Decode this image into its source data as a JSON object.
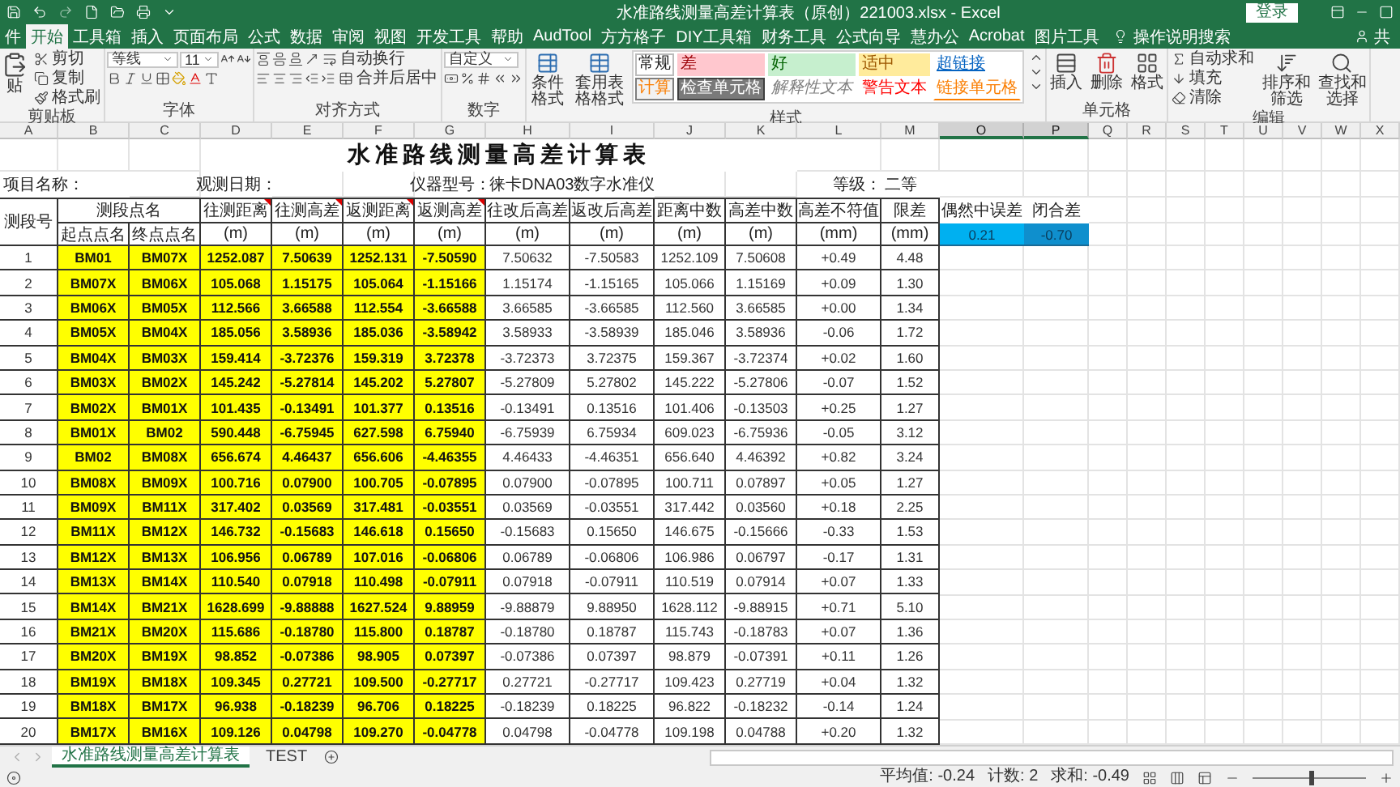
{
  "title_bar": {
    "title": "水准路线测量高差计算表（原创）221003.xlsx  -  Excel",
    "login": "登录"
  },
  "menu_tabs": [
    {
      "label": "件",
      "selected": false
    },
    {
      "label": "开始",
      "selected": true
    },
    {
      "label": "工具箱",
      "selected": false
    },
    {
      "label": "插入",
      "selected": false
    },
    {
      "label": "页面布局",
      "selected": false
    },
    {
      "label": "公式",
      "selected": false
    },
    {
      "label": "数据",
      "selected": false
    },
    {
      "label": "审阅",
      "selected": false
    },
    {
      "label": "视图",
      "selected": false
    },
    {
      "label": "开发工具",
      "selected": false
    },
    {
      "label": "帮助",
      "selected": false
    },
    {
      "label": "AudTool",
      "selected": false
    },
    {
      "label": "方方格子",
      "selected": false
    },
    {
      "label": "DIY工具箱",
      "selected": false
    },
    {
      "label": "财务工具",
      "selected": false
    },
    {
      "label": "公式向导",
      "selected": false
    },
    {
      "label": "慧办公",
      "selected": false
    },
    {
      "label": "Acrobat",
      "selected": false
    },
    {
      "label": "图片工具",
      "selected": false
    }
  ],
  "tell_me": "操作说明搜索",
  "share": "共",
  "ribbon": {
    "groups": [
      {
        "kind": "clipboard",
        "label": "剪贴板",
        "items": [
          "贴",
          "剪切",
          "复制",
          "格式刷"
        ]
      },
      {
        "kind": "font",
        "label": "字体",
        "font_name": "等线",
        "font_size": "11"
      },
      {
        "kind": "alignment",
        "label": "对齐方式",
        "items": [
          "自动换行",
          "合并后居中"
        ]
      },
      {
        "kind": "number",
        "label": "数字",
        "format": "自定义"
      },
      {
        "kind": "styles",
        "label": "样式",
        "buttons": [
          "条件格式",
          "套用表格格式"
        ],
        "styles": [
          {
            "label": "常规",
            "kind": "normal"
          },
          {
            "label": "差",
            "kind": "bad"
          },
          {
            "label": "好",
            "kind": "good"
          },
          {
            "label": "适中",
            "kind": "neutral"
          },
          {
            "label": "超链接",
            "kind": "hyperlink"
          },
          {
            "label": "计算",
            "kind": "calculation"
          },
          {
            "label": "检查单元格",
            "kind": "check"
          },
          {
            "label": "解释性文本",
            "kind": "explanatory"
          },
          {
            "label": "警告文本",
            "kind": "warning"
          },
          {
            "label": "链接单元格",
            "kind": "linked"
          }
        ]
      },
      {
        "kind": "cells",
        "label": "单元格",
        "items": [
          "插入",
          "删除",
          "格式"
        ]
      },
      {
        "kind": "editing",
        "label": "编辑",
        "items": [
          "自动求和",
          "填充",
          "清除"
        ],
        "buttons": [
          "排序和筛选",
          "查找和选择"
        ]
      }
    ]
  },
  "sheet": {
    "columns": [
      {
        "label": "A",
        "selected": false
      },
      {
        "label": "B",
        "selected": false
      },
      {
        "label": "C",
        "selected": false
      },
      {
        "label": "D",
        "selected": false
      },
      {
        "label": "E",
        "selected": false
      },
      {
        "label": "F",
        "selected": false
      },
      {
        "label": "G",
        "selected": false
      },
      {
        "label": "H",
        "selected": false
      },
      {
        "label": "I",
        "selected": false
      },
      {
        "label": "J",
        "selected": false
      },
      {
        "label": "K",
        "selected": false
      },
      {
        "label": "L",
        "selected": false
      },
      {
        "label": "M",
        "selected": false
      },
      {
        "label": "O",
        "selected": true
      },
      {
        "label": "P",
        "selected": true
      },
      {
        "label": "Q",
        "selected": false
      },
      {
        "label": "R",
        "selected": false
      },
      {
        "label": "S",
        "selected": false
      },
      {
        "label": "T",
        "selected": false
      },
      {
        "label": "U",
        "selected": false
      },
      {
        "label": "V",
        "selected": false
      },
      {
        "label": "W",
        "selected": false
      },
      {
        "label": "X",
        "selected": false
      }
    ],
    "title": "水准路线测量高差计算表",
    "info": {
      "project_label": "项目名称：",
      "date_label": "观测日期：",
      "instrument_label": "仪器型号：",
      "instrument": "徕卡DNA03数字水准仪",
      "grade_label": "等级：",
      "grade": "二等"
    },
    "table": {
      "segment_header": "测段号",
      "points_header": "测段点名",
      "point_headers": [
        "起点点名",
        "终点点名"
      ],
      "measure_headers": [
        {
          "label": "往测距离",
          "unit": "(m)",
          "comment": true
        },
        {
          "label": "往测高差",
          "unit": "(m)",
          "comment": true
        },
        {
          "label": "返测距离",
          "unit": "(m)",
          "comment": true
        },
        {
          "label": "返测高差",
          "unit": "(m)",
          "comment": true
        },
        {
          "label": "往改后高差",
          "unit": "(m)",
          "comment": false
        },
        {
          "label": "返改后高差",
          "unit": "(m)",
          "comment": false
        },
        {
          "label": "距离中数",
          "unit": "(m)",
          "comment": false
        },
        {
          "label": "高差中数",
          "unit": "(m)",
          "comment": false
        },
        {
          "label": "高差不符值",
          "unit": "(mm)",
          "comment": false
        },
        {
          "label": "限差",
          "unit": "(mm)",
          "comment": false
        }
      ],
      "rows": [
        {
          "no": "1",
          "cells": [
            "BM01",
            "BM07X",
            "1252.087",
            "7.50639",
            "1252.131",
            "-7.50590",
            "7.50632",
            "-7.50583",
            "1252.109",
            "7.50608",
            "+0.49",
            "4.48"
          ]
        },
        {
          "no": "2",
          "cells": [
            "BM07X",
            "BM06X",
            "105.068",
            "1.15175",
            "105.064",
            "-1.15166",
            "1.15174",
            "-1.15165",
            "105.066",
            "1.15169",
            "+0.09",
            "1.30"
          ]
        },
        {
          "no": "3",
          "cells": [
            "BM06X",
            "BM05X",
            "112.566",
            "3.66588",
            "112.554",
            "-3.66588",
            "3.66585",
            "-3.66585",
            "112.560",
            "3.66585",
            "+0.00",
            "1.34"
          ]
        },
        {
          "no": "4",
          "cells": [
            "BM05X",
            "BM04X",
            "185.056",
            "3.58936",
            "185.036",
            "-3.58942",
            "3.58933",
            "-3.58939",
            "185.046",
            "3.58936",
            "-0.06",
            "1.72"
          ]
        },
        {
          "no": "5",
          "cells": [
            "BM04X",
            "BM03X",
            "159.414",
            "-3.72376",
            "159.319",
            "3.72378",
            "-3.72373",
            "3.72375",
            "159.367",
            "-3.72374",
            "+0.02",
            "1.60"
          ]
        },
        {
          "no": "6",
          "cells": [
            "BM03X",
            "BM02X",
            "145.242",
            "-5.27814",
            "145.202",
            "5.27807",
            "-5.27809",
            "5.27802",
            "145.222",
            "-5.27806",
            "-0.07",
            "1.52"
          ]
        },
        {
          "no": "7",
          "cells": [
            "BM02X",
            "BM01X",
            "101.435",
            "-0.13491",
            "101.377",
            "0.13516",
            "-0.13491",
            "0.13516",
            "101.406",
            "-0.13503",
            "+0.25",
            "1.27"
          ]
        },
        {
          "no": "8",
          "cells": [
            "BM01X",
            "BM02",
            "590.448",
            "-6.75945",
            "627.598",
            "6.75940",
            "-6.75939",
            "6.75934",
            "609.023",
            "-6.75936",
            "-0.05",
            "3.12"
          ]
        },
        {
          "no": "9",
          "cells": [
            "BM02",
            "BM08X",
            "656.674",
            "4.46437",
            "656.606",
            "-4.46355",
            "4.46433",
            "-4.46351",
            "656.640",
            "4.46392",
            "+0.82",
            "3.24"
          ]
        },
        {
          "no": "10",
          "cells": [
            "BM08X",
            "BM09X",
            "100.716",
            "0.07900",
            "100.705",
            "-0.07895",
            "0.07900",
            "-0.07895",
            "100.711",
            "0.07897",
            "+0.05",
            "1.27"
          ]
        },
        {
          "no": "11",
          "cells": [
            "BM09X",
            "BM11X",
            "317.402",
            "0.03569",
            "317.481",
            "-0.03551",
            "0.03569",
            "-0.03551",
            "317.442",
            "0.03560",
            "+0.18",
            "2.25"
          ]
        },
        {
          "no": "12",
          "cells": [
            "BM11X",
            "BM12X",
            "146.732",
            "-0.15683",
            "146.618",
            "0.15650",
            "-0.15683",
            "0.15650",
            "146.675",
            "-0.15666",
            "-0.33",
            "1.53"
          ]
        },
        {
          "no": "13",
          "cells": [
            "BM12X",
            "BM13X",
            "106.956",
            "0.06789",
            "107.016",
            "-0.06806",
            "0.06789",
            "-0.06806",
            "106.986",
            "0.06797",
            "-0.17",
            "1.31"
          ]
        },
        {
          "no": "14",
          "cells": [
            "BM13X",
            "BM14X",
            "110.540",
            "0.07918",
            "110.498",
            "-0.07911",
            "0.07918",
            "-0.07911",
            "110.519",
            "0.07914",
            "+0.07",
            "1.33"
          ]
        },
        {
          "no": "15",
          "cells": [
            "BM14X",
            "BM21X",
            "1628.699",
            "-9.88888",
            "1627.524",
            "9.88959",
            "-9.88879",
            "9.88950",
            "1628.112",
            "-9.88915",
            "+0.71",
            "5.10"
          ]
        },
        {
          "no": "16",
          "cells": [
            "BM21X",
            "BM20X",
            "115.686",
            "-0.18780",
            "115.800",
            "0.18787",
            "-0.18780",
            "0.18787",
            "115.743",
            "-0.18783",
            "+0.07",
            "1.36"
          ]
        },
        {
          "no": "17",
          "cells": [
            "BM20X",
            "BM19X",
            "98.852",
            "-0.07386",
            "98.905",
            "0.07397",
            "-0.07386",
            "0.07397",
            "98.879",
            "-0.07391",
            "+0.11",
            "1.26"
          ]
        },
        {
          "no": "18",
          "cells": [
            "BM19X",
            "BM18X",
            "109.345",
            "0.27721",
            "109.500",
            "-0.27717",
            "0.27721",
            "-0.27717",
            "109.423",
            "0.27719",
            "+0.04",
            "1.32"
          ]
        },
        {
          "no": "19",
          "cells": [
            "BM18X",
            "BM17X",
            "96.938",
            "-0.18239",
            "96.706",
            "0.18225",
            "-0.18239",
            "0.18225",
            "96.822",
            "-0.18232",
            "-0.14",
            "1.24"
          ]
        },
        {
          "no": "20",
          "cells": [
            "BM17X",
            "BM16X",
            "109.126",
            "0.04798",
            "109.270",
            "-0.04778",
            "0.04798",
            "-0.04778",
            "109.198",
            "0.04788",
            "+0.20",
            "1.32"
          ]
        }
      ]
    },
    "summary": {
      "headers": [
        "偶然中误差",
        "闭合差"
      ],
      "values": [
        {
          "text": "0.21",
          "selected": true,
          "active": true
        },
        {
          "text": "-0.70",
          "selected": true,
          "active": false
        }
      ]
    }
  },
  "sheet_tabs": [
    {
      "label": "水准路线测量高差计算表",
      "selected": true
    },
    {
      "label": "TEST",
      "selected": false
    }
  ],
  "status_bar": {
    "items": [
      "平均值: -0.24",
      "计数: 2",
      "求和: -0.49"
    ],
    "zoom": {
      "level": 0.5
    }
  }
}
